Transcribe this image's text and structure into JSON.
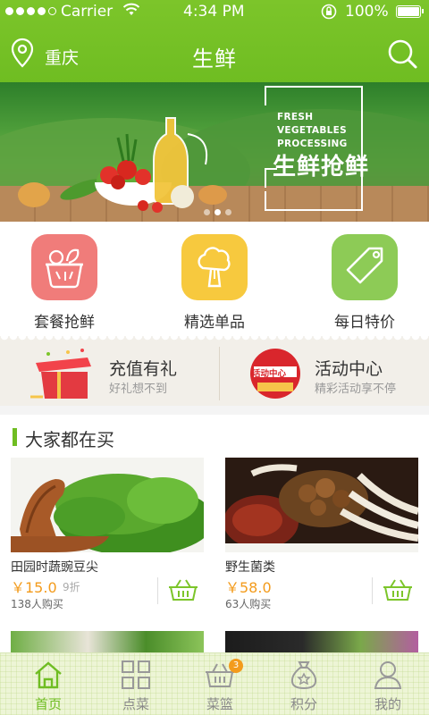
{
  "status_bar": {
    "carrier": "Carrier",
    "time": "4:34 PM",
    "battery": "100%"
  },
  "header": {
    "city": "重庆",
    "title": "生鲜",
    "icons": [
      "location-pin-icon",
      "search-icon"
    ]
  },
  "banner": {
    "headline_en": [
      "FRESH",
      "VEGETABLES",
      "PROCESSING"
    ],
    "headline_cn": "生鲜抢鲜",
    "pages": 3,
    "active_page": 2
  },
  "categories": [
    {
      "label": "套餐抢鲜",
      "icon": "basket-of-vegetables-icon",
      "color": "#f07c7a"
    },
    {
      "label": "精选单品",
      "icon": "broccoli-icon",
      "color": "#f7c93e"
    },
    {
      "label": "每日特价",
      "icon": "price-tag-icon",
      "color": "#8dcb56"
    }
  ],
  "promos": [
    {
      "title": "充值有礼",
      "subtitle": "好礼想不到",
      "icon": "gift-box-icon"
    },
    {
      "title": "活动中心",
      "subtitle": "精彩活动享不停",
      "icon": "event-badge-icon",
      "badge_text": "活动中心"
    }
  ],
  "section": {
    "title": "大家都在买"
  },
  "products": [
    {
      "name": "田园时蔬豌豆尖",
      "price": "￥15.0",
      "discount": "9折",
      "sold": "138人购买"
    },
    {
      "name": "野生菌类",
      "price": "￥58.0",
      "discount": "",
      "sold": "63人购买"
    }
  ],
  "tabbar": [
    {
      "label": "首页",
      "icon": "home-icon",
      "active": true
    },
    {
      "label": "点菜",
      "icon": "grid-icon",
      "active": false
    },
    {
      "label": "菜篮",
      "icon": "basket-icon",
      "active": false,
      "badge": "3"
    },
    {
      "label": "积分",
      "icon": "money-bag-icon",
      "active": false
    },
    {
      "label": "我的",
      "icon": "user-icon",
      "active": false
    }
  ],
  "colors": {
    "brand_green": "#6fbd22",
    "price_orange": "#f39b1c"
  }
}
